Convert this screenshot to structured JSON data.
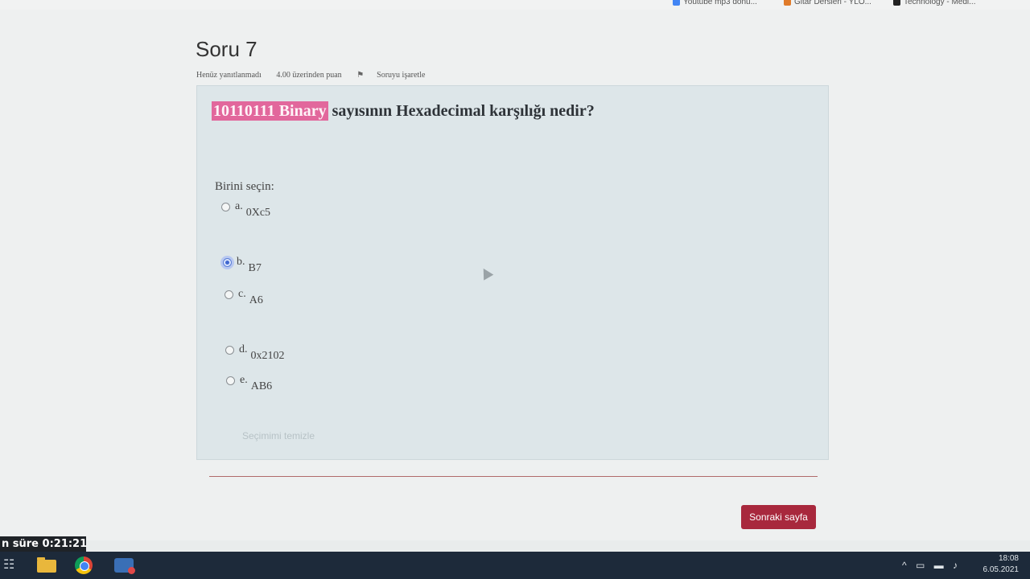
{
  "bookmarks": [
    {
      "label": "Youtube mp3 donu...",
      "icon_color": "#4285f4"
    },
    {
      "label": "Gitar Dersleri - YLO...",
      "icon_color": "#e07b2a"
    },
    {
      "label": "Technology - Medi...",
      "icon_color": "#222222"
    }
  ],
  "question": {
    "title": "Soru 7",
    "meta": {
      "status": "Henüz yanıtlanmadı",
      "points": "4.00 üzerinden puan",
      "flag": "Soruyu işaretle"
    },
    "text_highlight": "10110111  Binary",
    "text_rest": " sayısının Hexadecimal karşılığı nedir?",
    "prompt": "Birini seçin:",
    "options": [
      {
        "letter": "a.",
        "value": "0Xc5",
        "selected": false
      },
      {
        "letter": "b.",
        "value": "B7",
        "selected": true
      },
      {
        "letter": "c.",
        "value": "A6",
        "selected": false
      },
      {
        "letter": "d.",
        "value": "0x2102",
        "selected": false
      },
      {
        "letter": "e.",
        "value": "AB6",
        "selected": false
      }
    ],
    "clear_label": "Seçimimi temizle"
  },
  "navigation": {
    "next_label": "Sonraki sayfa"
  },
  "timer": {
    "text": "n süre 0:21:21"
  },
  "taskbar": {
    "time": "18:08",
    "date": "6.05.2021"
  },
  "colors": {
    "highlight": "#e2679c",
    "next_button": "#a8283d",
    "question_box": "#dde6e9"
  }
}
